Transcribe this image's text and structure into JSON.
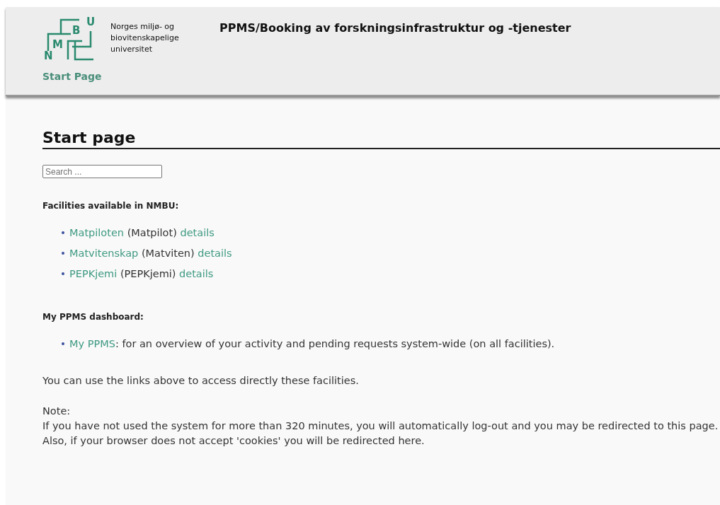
{
  "header": {
    "logo_letters": [
      "U",
      "B",
      "M",
      "N"
    ],
    "institution": [
      "Norges miljø- og",
      "biovitenskapelige",
      "universitet"
    ],
    "title": "PPMS/Booking av forskningsinfrastruktur og -tjenester",
    "nav": [
      {
        "label": "Start Page",
        "selected": true
      }
    ]
  },
  "page_title": "Start page",
  "search": {
    "placeholder": "Search ..."
  },
  "facilities": {
    "heading": "Facilities available in NMBU:",
    "items": [
      {
        "name": "Matpiloten",
        "code": "(Matpilot)",
        "link": "details"
      },
      {
        "name": "Matvitenskap",
        "code": "(Matviten)",
        "link": "details"
      },
      {
        "name": "PEPKjemi",
        "code": "(PEPKjemi)",
        "link": "details"
      }
    ]
  },
  "dashboard": {
    "heading": "My PPMS dashboard:",
    "items": [
      {
        "link": "My PPMS",
        "text": ": for an overview of your activity and pending requests system-wide (on all facilities)."
      }
    ]
  },
  "info": "You can use the links above to access directly these facilities.",
  "note": {
    "label": "Note:",
    "lines": [
      "If you have not used the system for more than 320 minutes, you will automatically log-out and you may be redirected to this page.",
      "Also, if your browser does not accept 'cookies' you will be redirected here."
    ]
  }
}
